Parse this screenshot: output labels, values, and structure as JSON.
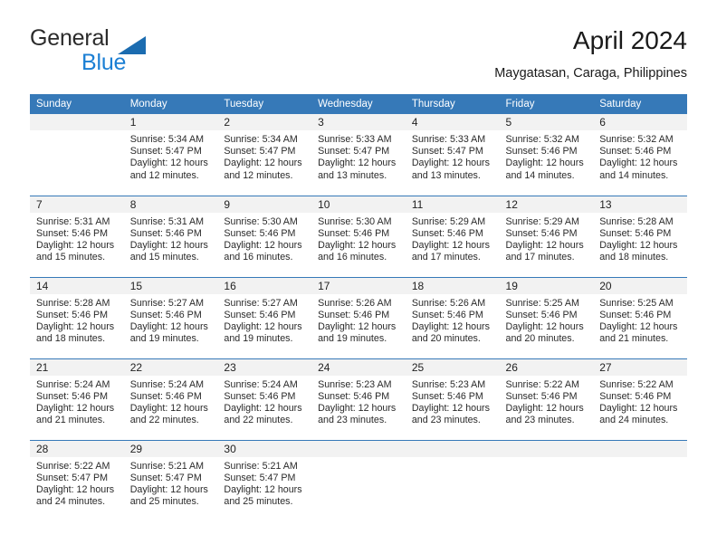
{
  "brand": {
    "name_part1": "General",
    "name_part2": "Blue",
    "logo_icon": "triangle-flag-icon",
    "color_blue": "#1b7fd4",
    "color_triangle": "#1b6cb0"
  },
  "header": {
    "title": "April 2024",
    "subtitle": "Maygatasan, Caraga, Philippines"
  },
  "theme": {
    "header_bar": "#3679b8",
    "daynum_band": "#f2f2f2",
    "text": "#2a2a2a"
  },
  "weekdays": [
    "Sunday",
    "Monday",
    "Tuesday",
    "Wednesday",
    "Thursday",
    "Friday",
    "Saturday"
  ],
  "weeks": [
    [
      {
        "day": "",
        "empty": true,
        "sunrise": "",
        "sunset": "",
        "daylight1": "",
        "daylight2": ""
      },
      {
        "day": "1",
        "sunrise": "Sunrise: 5:34 AM",
        "sunset": "Sunset: 5:47 PM",
        "daylight1": "Daylight: 12 hours",
        "daylight2": "and 12 minutes."
      },
      {
        "day": "2",
        "sunrise": "Sunrise: 5:34 AM",
        "sunset": "Sunset: 5:47 PM",
        "daylight1": "Daylight: 12 hours",
        "daylight2": "and 12 minutes."
      },
      {
        "day": "3",
        "sunrise": "Sunrise: 5:33 AM",
        "sunset": "Sunset: 5:47 PM",
        "daylight1": "Daylight: 12 hours",
        "daylight2": "and 13 minutes."
      },
      {
        "day": "4",
        "sunrise": "Sunrise: 5:33 AM",
        "sunset": "Sunset: 5:47 PM",
        "daylight1": "Daylight: 12 hours",
        "daylight2": "and 13 minutes."
      },
      {
        "day": "5",
        "sunrise": "Sunrise: 5:32 AM",
        "sunset": "Sunset: 5:46 PM",
        "daylight1": "Daylight: 12 hours",
        "daylight2": "and 14 minutes."
      },
      {
        "day": "6",
        "sunrise": "Sunrise: 5:32 AM",
        "sunset": "Sunset: 5:46 PM",
        "daylight1": "Daylight: 12 hours",
        "daylight2": "and 14 minutes."
      }
    ],
    [
      {
        "day": "7",
        "sunrise": "Sunrise: 5:31 AM",
        "sunset": "Sunset: 5:46 PM",
        "daylight1": "Daylight: 12 hours",
        "daylight2": "and 15 minutes."
      },
      {
        "day": "8",
        "sunrise": "Sunrise: 5:31 AM",
        "sunset": "Sunset: 5:46 PM",
        "daylight1": "Daylight: 12 hours",
        "daylight2": "and 15 minutes."
      },
      {
        "day": "9",
        "sunrise": "Sunrise: 5:30 AM",
        "sunset": "Sunset: 5:46 PM",
        "daylight1": "Daylight: 12 hours",
        "daylight2": "and 16 minutes."
      },
      {
        "day": "10",
        "sunrise": "Sunrise: 5:30 AM",
        "sunset": "Sunset: 5:46 PM",
        "daylight1": "Daylight: 12 hours",
        "daylight2": "and 16 minutes."
      },
      {
        "day": "11",
        "sunrise": "Sunrise: 5:29 AM",
        "sunset": "Sunset: 5:46 PM",
        "daylight1": "Daylight: 12 hours",
        "daylight2": "and 17 minutes."
      },
      {
        "day": "12",
        "sunrise": "Sunrise: 5:29 AM",
        "sunset": "Sunset: 5:46 PM",
        "daylight1": "Daylight: 12 hours",
        "daylight2": "and 17 minutes."
      },
      {
        "day": "13",
        "sunrise": "Sunrise: 5:28 AM",
        "sunset": "Sunset: 5:46 PM",
        "daylight1": "Daylight: 12 hours",
        "daylight2": "and 18 minutes."
      }
    ],
    [
      {
        "day": "14",
        "sunrise": "Sunrise: 5:28 AM",
        "sunset": "Sunset: 5:46 PM",
        "daylight1": "Daylight: 12 hours",
        "daylight2": "and 18 minutes."
      },
      {
        "day": "15",
        "sunrise": "Sunrise: 5:27 AM",
        "sunset": "Sunset: 5:46 PM",
        "daylight1": "Daylight: 12 hours",
        "daylight2": "and 19 minutes."
      },
      {
        "day": "16",
        "sunrise": "Sunrise: 5:27 AM",
        "sunset": "Sunset: 5:46 PM",
        "daylight1": "Daylight: 12 hours",
        "daylight2": "and 19 minutes."
      },
      {
        "day": "17",
        "sunrise": "Sunrise: 5:26 AM",
        "sunset": "Sunset: 5:46 PM",
        "daylight1": "Daylight: 12 hours",
        "daylight2": "and 19 minutes."
      },
      {
        "day": "18",
        "sunrise": "Sunrise: 5:26 AM",
        "sunset": "Sunset: 5:46 PM",
        "daylight1": "Daylight: 12 hours",
        "daylight2": "and 20 minutes."
      },
      {
        "day": "19",
        "sunrise": "Sunrise: 5:25 AM",
        "sunset": "Sunset: 5:46 PM",
        "daylight1": "Daylight: 12 hours",
        "daylight2": "and 20 minutes."
      },
      {
        "day": "20",
        "sunrise": "Sunrise: 5:25 AM",
        "sunset": "Sunset: 5:46 PM",
        "daylight1": "Daylight: 12 hours",
        "daylight2": "and 21 minutes."
      }
    ],
    [
      {
        "day": "21",
        "sunrise": "Sunrise: 5:24 AM",
        "sunset": "Sunset: 5:46 PM",
        "daylight1": "Daylight: 12 hours",
        "daylight2": "and 21 minutes."
      },
      {
        "day": "22",
        "sunrise": "Sunrise: 5:24 AM",
        "sunset": "Sunset: 5:46 PM",
        "daylight1": "Daylight: 12 hours",
        "daylight2": "and 22 minutes."
      },
      {
        "day": "23",
        "sunrise": "Sunrise: 5:24 AM",
        "sunset": "Sunset: 5:46 PM",
        "daylight1": "Daylight: 12 hours",
        "daylight2": "and 22 minutes."
      },
      {
        "day": "24",
        "sunrise": "Sunrise: 5:23 AM",
        "sunset": "Sunset: 5:46 PM",
        "daylight1": "Daylight: 12 hours",
        "daylight2": "and 23 minutes."
      },
      {
        "day": "25",
        "sunrise": "Sunrise: 5:23 AM",
        "sunset": "Sunset: 5:46 PM",
        "daylight1": "Daylight: 12 hours",
        "daylight2": "and 23 minutes."
      },
      {
        "day": "26",
        "sunrise": "Sunrise: 5:22 AM",
        "sunset": "Sunset: 5:46 PM",
        "daylight1": "Daylight: 12 hours",
        "daylight2": "and 23 minutes."
      },
      {
        "day": "27",
        "sunrise": "Sunrise: 5:22 AM",
        "sunset": "Sunset: 5:46 PM",
        "daylight1": "Daylight: 12 hours",
        "daylight2": "and 24 minutes."
      }
    ],
    [
      {
        "day": "28",
        "sunrise": "Sunrise: 5:22 AM",
        "sunset": "Sunset: 5:47 PM",
        "daylight1": "Daylight: 12 hours",
        "daylight2": "and 24 minutes."
      },
      {
        "day": "29",
        "sunrise": "Sunrise: 5:21 AM",
        "sunset": "Sunset: 5:47 PM",
        "daylight1": "Daylight: 12 hours",
        "daylight2": "and 25 minutes."
      },
      {
        "day": "30",
        "sunrise": "Sunrise: 5:21 AM",
        "sunset": "Sunset: 5:47 PM",
        "daylight1": "Daylight: 12 hours",
        "daylight2": "and 25 minutes."
      },
      {
        "day": "",
        "empty": true,
        "sunrise": "",
        "sunset": "",
        "daylight1": "",
        "daylight2": ""
      },
      {
        "day": "",
        "empty": true,
        "sunrise": "",
        "sunset": "",
        "daylight1": "",
        "daylight2": ""
      },
      {
        "day": "",
        "empty": true,
        "sunrise": "",
        "sunset": "",
        "daylight1": "",
        "daylight2": ""
      },
      {
        "day": "",
        "empty": true,
        "sunrise": "",
        "sunset": "",
        "daylight1": "",
        "daylight2": ""
      }
    ]
  ]
}
